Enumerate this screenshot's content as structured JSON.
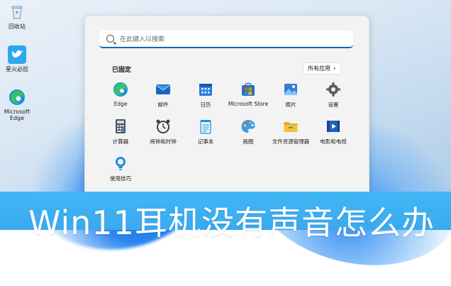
{
  "desktop_icons": [
    {
      "label": "回收站",
      "icon": "recycle-bin-icon"
    },
    {
      "label": "星火必应",
      "icon": "bird-app-icon"
    },
    {
      "label": "Microsoft Edge",
      "icon": "edge-icon"
    }
  ],
  "start_menu": {
    "search_placeholder": "在此键入以搜索",
    "pinned_title": "已固定",
    "all_apps_label": "所有应用",
    "apps": [
      {
        "label": "Edge",
        "icon": "edge-icon",
        "color": "#1b8fd6"
      },
      {
        "label": "邮件",
        "icon": "mail-icon",
        "color": "#1467c4"
      },
      {
        "label": "日历",
        "icon": "calendar-icon",
        "color": "#1c6cd0"
      },
      {
        "label": "Microsoft Store",
        "icon": "store-icon",
        "color": "#2b6fc4"
      },
      {
        "label": "照片",
        "icon": "photos-icon",
        "color": "#3a7bd5"
      },
      {
        "label": "设置",
        "icon": "gear-icon",
        "color": "#5a5f66"
      },
      {
        "label": "计算器",
        "icon": "calculator-icon",
        "color": "#4a5160"
      },
      {
        "label": "闹钟和时钟",
        "icon": "clock-icon",
        "color": "#3b3f46"
      },
      {
        "label": "记事本",
        "icon": "notepad-icon",
        "color": "#1f8fd8"
      },
      {
        "label": "画图",
        "icon": "paint-icon",
        "color": "#3c9be6"
      },
      {
        "label": "文件资源管理器",
        "icon": "folder-icon",
        "color": "#f5c12e"
      },
      {
        "label": "电影和电视",
        "icon": "movies-icon",
        "color": "#1f5fbf"
      },
      {
        "label": "使用技巧",
        "icon": "tips-icon",
        "color": "#1b8fd6"
      }
    ]
  },
  "banner": {
    "title": "Win11耳机没有声音怎么办"
  }
}
